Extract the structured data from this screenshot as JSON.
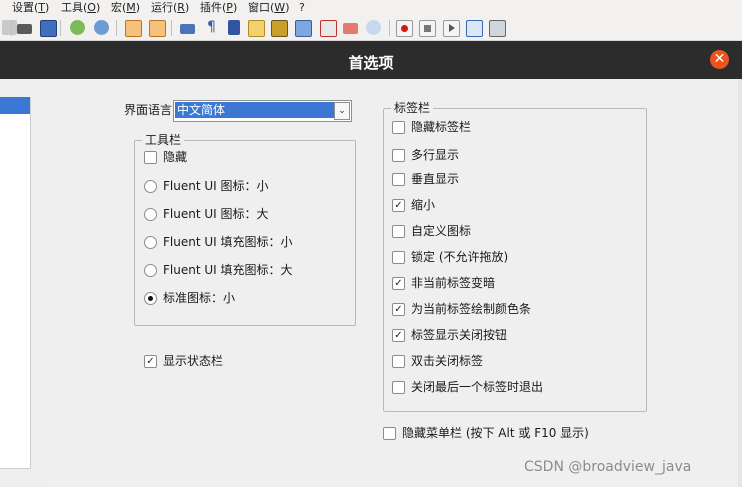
{
  "menubar": {
    "items": [
      {
        "label": "设置(",
        "key": "T",
        "tail": ")"
      },
      {
        "label": "工具(",
        "key": "O",
        "tail": ")"
      },
      {
        "label": "宏(",
        "key": "M",
        "tail": ")"
      },
      {
        "label": "运行(",
        "key": "R",
        "tail": ")"
      },
      {
        "label": "插件(",
        "key": "P",
        "tail": ")"
      },
      {
        "label": "窗口(",
        "key": "W",
        "tail": ")"
      },
      {
        "label": "?",
        "key": "",
        "tail": ""
      }
    ]
  },
  "dialog": {
    "title": "首选项",
    "close_label": "✕"
  },
  "language": {
    "label": "界面语言",
    "value": "中文简体",
    "arrow": "⌄"
  },
  "toolbar_group": {
    "legend": "工具栏",
    "hide_label": "隐藏",
    "hide_checked": false,
    "options": [
      {
        "label": "Fluent UI 图标：小",
        "selected": false
      },
      {
        "label": "Fluent UI 图标：大",
        "selected": false
      },
      {
        "label": "Fluent UI 填充图标：小",
        "selected": false
      },
      {
        "label": "Fluent UI 填充图标：大",
        "selected": false
      },
      {
        "label": "标准图标：小",
        "selected": true
      }
    ]
  },
  "statusbar": {
    "label": "显示状态栏",
    "checked": true
  },
  "tabbar_group": {
    "legend": "标签栏",
    "options": [
      {
        "label": "隐藏标签栏",
        "checked": false
      },
      {
        "label": "多行显示",
        "checked": false
      },
      {
        "label": "垂直显示",
        "checked": false
      },
      {
        "label": "缩小",
        "checked": true
      },
      {
        "label": "自定义图标",
        "checked": false
      },
      {
        "label": "锁定 (不允许拖放)",
        "checked": false
      },
      {
        "label": "非当前标签变暗",
        "checked": true
      },
      {
        "label": "为当前标签绘制颜色条",
        "checked": true
      },
      {
        "label": "标签显示关闭按钮",
        "checked": true
      },
      {
        "label": "双击关闭标签",
        "checked": false
      },
      {
        "label": "关闭最后一个标签时退出",
        "checked": false
      }
    ]
  },
  "hide_menubar": {
    "label": "隐藏菜单栏 (按下 Alt 或 F10 显示)",
    "checked": false
  },
  "watermark": "CSDN @broadview_java",
  "colors": {
    "accent": "#3a78d4",
    "close": "#e9541f",
    "titlebar": "#2c2c2c"
  },
  "toolbar_icons": [
    "print-icon",
    "find-replace-icon",
    "zoom-in-icon",
    "zoom-out-icon",
    "sync-vertical-icon",
    "sync-horizontal-icon",
    "word-wrap-icon",
    "show-all-chars-icon",
    "indent-guide-icon",
    "user-language-icon",
    "doc-map-icon",
    "doc-list-icon",
    "function-list-icon",
    "folder-workspace-icon",
    "monitoring-icon",
    "record-macro-icon",
    "stop-macro-icon",
    "play-macro-icon",
    "run-macro-multiple-icon",
    "save-macro-icon"
  ]
}
